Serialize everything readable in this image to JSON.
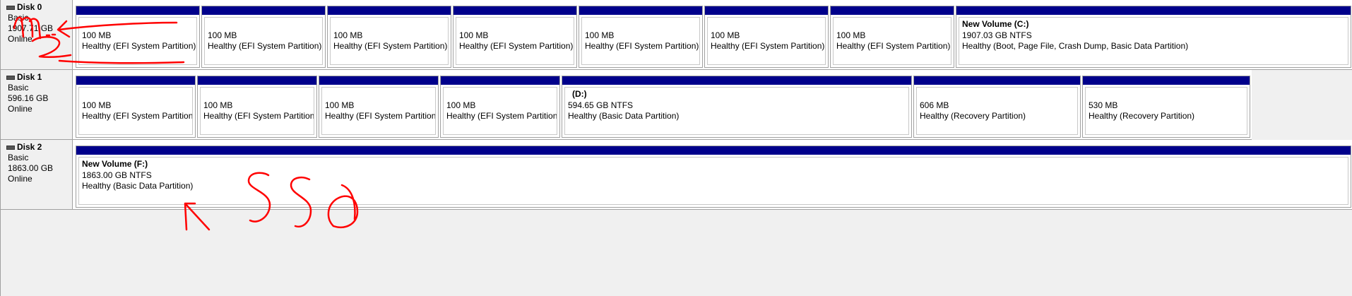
{
  "disks": [
    {
      "name": "Disk 0",
      "type": "Basic",
      "size": "1907.71 GB",
      "status": "Online",
      "partitions": [
        {
          "volume": "",
          "size": "100 MB",
          "status": "Healthy (EFI System Partition)"
        },
        {
          "volume": "",
          "size": "100 MB",
          "status": "Healthy (EFI System Partition)"
        },
        {
          "volume": "",
          "size": "100 MB",
          "status": "Healthy (EFI System Partition)"
        },
        {
          "volume": "",
          "size": "100 MB",
          "status": "Healthy (EFI System Partition)"
        },
        {
          "volume": "",
          "size": "100 MB",
          "status": "Healthy (EFI System Partition)"
        },
        {
          "volume": "",
          "size": "100 MB",
          "status": "Healthy (EFI System Partition)"
        },
        {
          "volume": "",
          "size": "100 MB",
          "status": "Healthy (EFI System Partition)"
        },
        {
          "volume": "New Volume  (C:)",
          "size": "1907.03 GB NTFS",
          "status": "Healthy (Boot, Page File, Crash Dump, Basic Data Partition)"
        }
      ]
    },
    {
      "name": "Disk 1",
      "type": "Basic",
      "size": "596.16 GB",
      "status": "Online",
      "partitions": [
        {
          "volume": "",
          "size": "100 MB",
          "status": "Healthy (EFI System Partition)"
        },
        {
          "volume": "",
          "size": "100 MB",
          "status": "Healthy (EFI System Partition)"
        },
        {
          "volume": "",
          "size": "100 MB",
          "status": "Healthy (EFI System Partition)"
        },
        {
          "volume": "",
          "size": "100 MB",
          "status": "Healthy (EFI System Partition)"
        },
        {
          "volume": "(D:)",
          "size": "594.65 GB NTFS",
          "status": "Healthy (Basic Data Partition)"
        },
        {
          "volume": "",
          "size": "606 MB",
          "status": "Healthy (Recovery Partition)"
        },
        {
          "volume": "",
          "size": "530 MB",
          "status": "Healthy (Recovery Partition)"
        }
      ]
    },
    {
      "name": "Disk 2",
      "type": "Basic",
      "size": "1863.00 GB",
      "status": "Online",
      "partitions": [
        {
          "volume": "New Volume  (F:)",
          "size": "1863.00 GB NTFS",
          "status": "Healthy (Basic Data Partition)"
        }
      ]
    }
  ],
  "colors": {
    "partition_bar": "#00008b",
    "annotation": "#ff0000",
    "background": "#f0f0f0"
  }
}
